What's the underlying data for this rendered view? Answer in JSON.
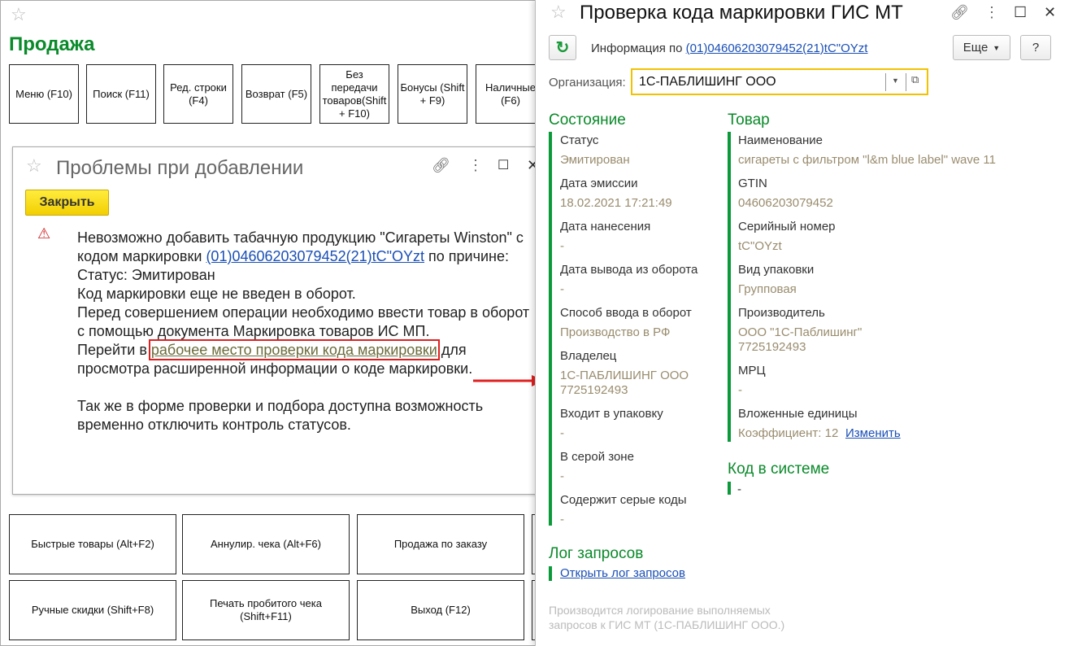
{
  "main": {
    "title": "Продажа",
    "top_buttons": [
      "Меню (F10)",
      "Поиск (F11)",
      "Ред. строки (F4)",
      "Возврат (F5)",
      "Без передачи товаров(Shift + F10)",
      "Бонусы (Shift + F9)",
      "Наличные (F6)"
    ],
    "bottom_buttons": [
      "Быстрые товары (Alt+F2)",
      "Аннулир. чека (Alt+F6)",
      "Продажа по заказу",
      "Ручные скидки (Shift+F8)",
      "Печать пробитого чека (Shift+F11)",
      "Выход (F12)"
    ]
  },
  "dialog": {
    "title": "Проблемы при добавлении",
    "close_label": "Закрыть",
    "msg1": "Невозможно добавить табачную продукцию \"Сигареты Winston\" с кодом маркировки ",
    "code_link": "(01)04606203079452(21)tC\"OYzt",
    "msg2": " по причине:",
    "line_status": "Статус: Эмитирован",
    "line2": "Код маркировки еще не введен в оборот.",
    "line3": "Перед совершением операции необходимо ввести товар в оборот",
    "line4": "с помощью документа Маркировка товаров ИС МП.",
    "line5a": "Перейти в ",
    "workplace_link": "рабочее место проверки кода маркировки",
    "line5b": " для просмотра расширенной информации о коде маркировки.",
    "line6": "Так же в форме проверки и подбора доступна возможность временно отключить контроль статусов."
  },
  "panel": {
    "title": "Проверка кода маркировки ГИС МТ",
    "info_prefix": "Информация по ",
    "info_link": "(01)04606203079452(21)tC\"OYzt",
    "more_label": "Еще",
    "help_label": "?",
    "org_label": "Организация:",
    "org_value": "1С-ПАБЛИШИНГ ООО",
    "state_title": "Состояние",
    "state": [
      {
        "label": "Статус",
        "value": "Эмитирован"
      },
      {
        "label": "Дата эмиссии",
        "value": "18.02.2021 17:21:49"
      },
      {
        "label": "Дата нанесения",
        "value": "-"
      },
      {
        "label": "Дата вывода из оборота",
        "value": "-"
      },
      {
        "label": "Способ ввода в оборот",
        "value": "Производство в РФ"
      },
      {
        "label": "Владелец",
        "value": "1С-ПАБЛИШИНГ ООО\n7725192493"
      },
      {
        "label": "Входит в упаковку",
        "value": "-"
      },
      {
        "label": "В серой зоне",
        "value": "-"
      },
      {
        "label": "Содержит серые коды",
        "value": "-"
      }
    ],
    "goods_title": "Товар",
    "goods": [
      {
        "label": "Наименование",
        "value": "сигареты с фильтром \"l&m blue label\" wave 11"
      },
      {
        "label": "GTIN",
        "value": "04606203079452"
      },
      {
        "label": "Серийный номер",
        "value": "tC\"OYzt"
      },
      {
        "label": "Вид упаковки",
        "value": "Групповая"
      },
      {
        "label": "Производитель",
        "value": "ООО \"1С-Паблишинг\"\n7725192493"
      },
      {
        "label": "МРЦ",
        "value": "-"
      },
      {
        "label": "Вложенные единицы",
        "value": "Коэффициент: 12 "
      }
    ],
    "change_link": "Изменить",
    "code_title": "Код в системе",
    "code_value": "-",
    "log_title": "Лог запросов",
    "log_link": "Открыть лог запросов",
    "footer": "Производится логирование выполняемых запросов к ГИС МТ (1С-ПАБЛИШИНГ ООО.)"
  },
  "colors": {
    "accent_green": "#0a8a2a",
    "link": "#1a4fb5",
    "highlight": "#e02020",
    "close_button": "#f2cf00"
  }
}
